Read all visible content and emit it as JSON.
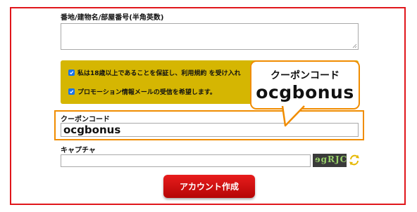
{
  "form": {
    "address_label": "番地/建物名/部屋番号(半角英数)",
    "address_value": "",
    "consent": {
      "age_text": "私は18歳以上であることを保証し、利用規約 を受け入れ",
      "promo_text": "プロモーション情報メールの受信を希望します。",
      "age_checked": true,
      "promo_checked": true
    },
    "coupon_label": "クーポンコード",
    "coupon_value": "ocgbonus",
    "captcha_label": "キャプチャ",
    "captcha_value": "",
    "captcha_image_text": "ɘgRJC",
    "submit_label": "アカウント作成"
  },
  "callout": {
    "title": "クーポンコード",
    "code": "ocgbonus"
  },
  "colors": {
    "frame_border": "#e0161b",
    "highlight_orange": "#f08c00",
    "consent_bg": "#d5b602",
    "checkbox_blue": "#1a73e8",
    "submit_red": "#d01010"
  },
  "icons": {
    "refresh": "refresh-arrows-icon",
    "check": "check-icon"
  }
}
